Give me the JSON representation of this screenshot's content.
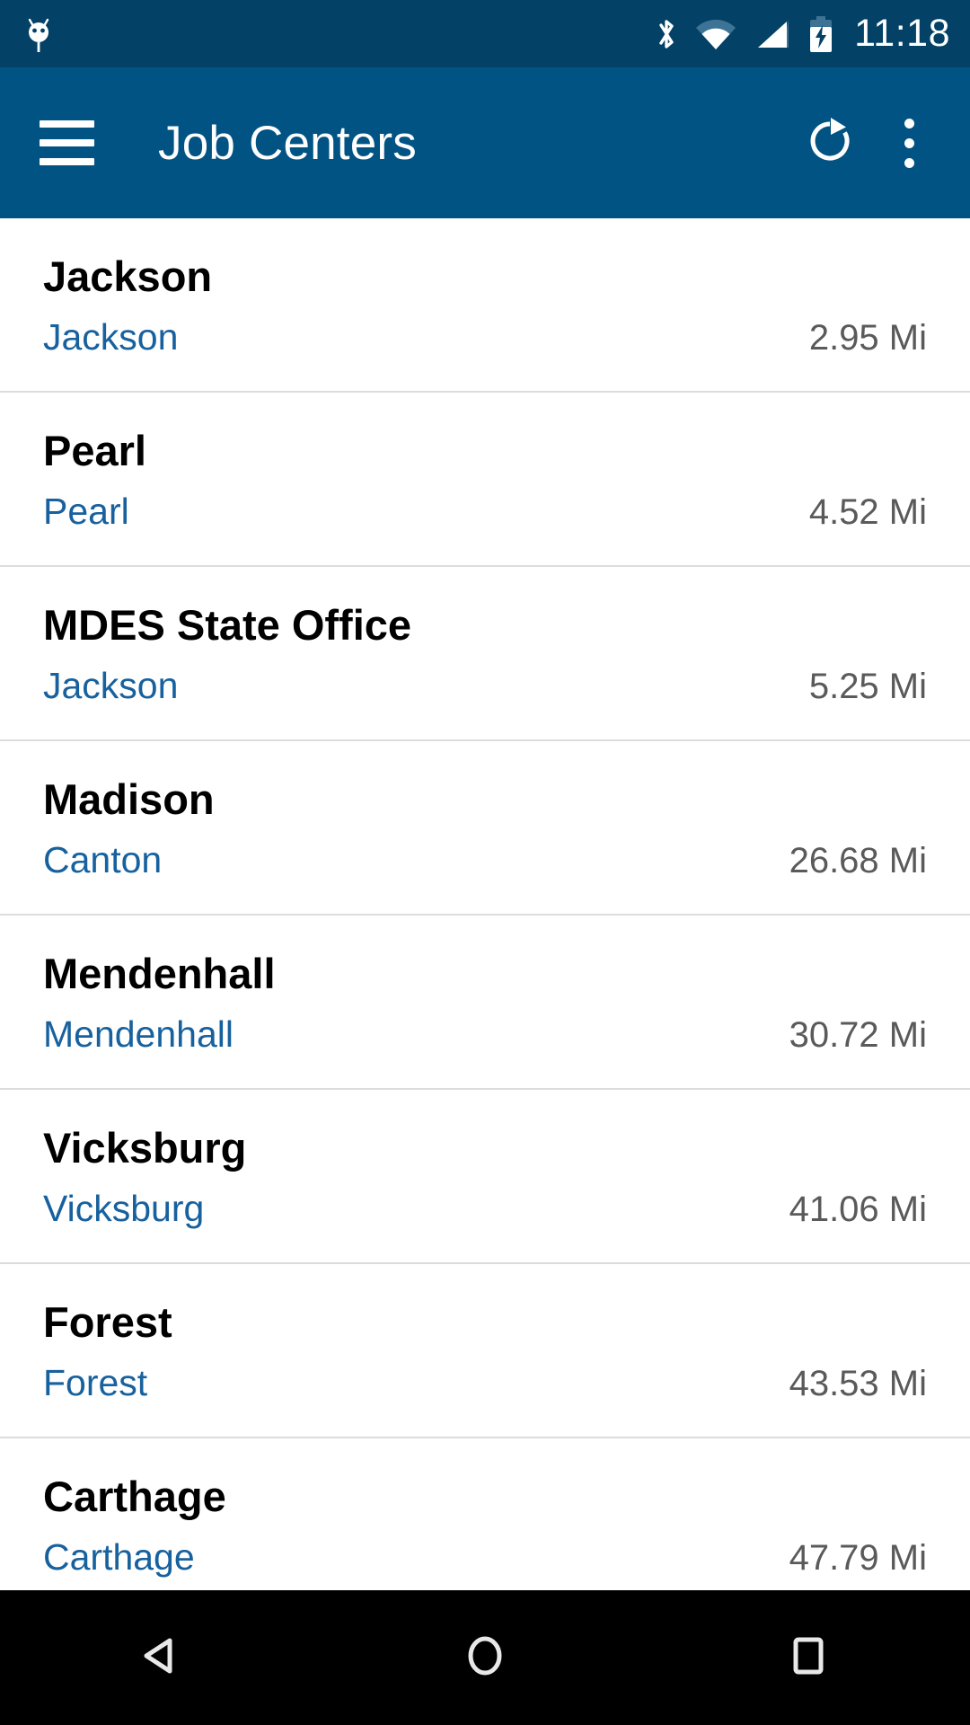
{
  "status_bar": {
    "notification_icon": "android-robot-icon",
    "icons": [
      "bluetooth-icon",
      "wifi-icon",
      "cell-signal-icon",
      "battery-charging-icon"
    ],
    "time": "11:18",
    "background_color": "#034166"
  },
  "app_bar": {
    "menu_icon": "hamburger-menu-icon",
    "title": "Job Centers",
    "refresh_icon": "refresh-icon",
    "overflow_icon": "overflow-menu-icon",
    "background_color": "#015384"
  },
  "list": {
    "title_color": "#000000",
    "city_color": "#17619e",
    "distance_color": "#5a5a5a",
    "divider_color": "#dcdcdc",
    "items": [
      {
        "name": "Jackson",
        "city": "Jackson",
        "distance": "2.95 Mi"
      },
      {
        "name": "Pearl",
        "city": "Pearl",
        "distance": "4.52 Mi"
      },
      {
        "name": "MDES State Office",
        "city": "Jackson",
        "distance": "5.25 Mi"
      },
      {
        "name": "Madison",
        "city": "Canton",
        "distance": "26.68 Mi"
      },
      {
        "name": "Mendenhall",
        "city": "Mendenhall",
        "distance": "30.72 Mi"
      },
      {
        "name": "Vicksburg",
        "city": "Vicksburg",
        "distance": "41.06 Mi"
      },
      {
        "name": "Forest",
        "city": "Forest",
        "distance": "43.53 Mi"
      },
      {
        "name": "Carthage",
        "city": "Carthage",
        "distance": "47.79 Mi"
      }
    ]
  },
  "nav_bar": {
    "back_icon": "back-triangle-icon",
    "home_icon": "home-circle-icon",
    "recents_icon": "recents-square-icon",
    "background_color": "#000000"
  }
}
